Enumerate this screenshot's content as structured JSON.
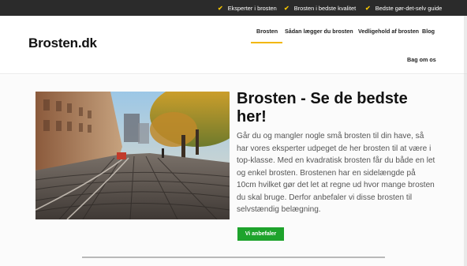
{
  "topbar": {
    "check_icon": "✔",
    "items": [
      {
        "label": "Eksperter i brosten"
      },
      {
        "label": "Brosten i bedste kvalitet"
      },
      {
        "label": "Bedste gør-det-selv guide"
      }
    ]
  },
  "header": {
    "logo": "Brosten.dk",
    "nav": [
      {
        "label": "Brosten"
      },
      {
        "label": "Sådan lægger du brosten"
      },
      {
        "label": "Vedligehold af brosten"
      },
      {
        "label": "Blog"
      },
      {
        "label": "Bag om os"
      }
    ]
  },
  "hero": {
    "title": "Brosten - Se de bedste her!",
    "body": "Går du og mangler nogle små brosten til din have, så har vores eksperter udpeget de her brosten til at være i top-klasse. Med en kvadratisk brosten får du både en let og enkel brosten. Brostenen har en sidelængde på 10cm hvilket gør det let at regne ud hvor mange brosten du skal bruge. Derfor anbefaler vi disse brosten til selvstændig belægning.",
    "cta": "Vi anbefaler"
  },
  "colors": {
    "accent": "#f2b705",
    "cta": "#1ea32c",
    "topbar": "#2b2b2b"
  }
}
